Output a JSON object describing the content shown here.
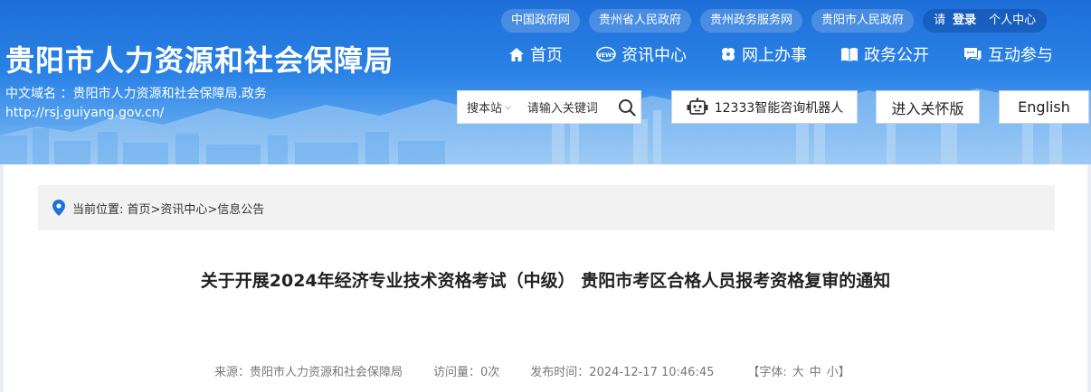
{
  "top_links": [
    "中国政府网",
    "贵州省人民政府",
    "贵州政务服务网",
    "贵阳市人民政府"
  ],
  "login": {
    "please": "请",
    "login": "登录",
    "personal": "个人中心"
  },
  "site": {
    "title": "贵阳市人力资源和社会保障局",
    "domain_label": "中文域名 ：贵阳市人力资源和社会保障局.政务",
    "url": "http://rsj.guiyang.gov.cn/"
  },
  "nav": [
    "首页",
    "资讯中心",
    "网上办事",
    "政务公开",
    "互动参与"
  ],
  "search": {
    "scope": "搜本站",
    "placeholder": "请输入关键词"
  },
  "robot_label": "12333智能咨询机器人",
  "care_label": "进入关怀版",
  "english_label": "English",
  "breadcrumb": "当前位置: 首页>资讯中心>信息公告",
  "article": {
    "title": "关于开展2024年经济专业技术资格考试（中级） 贵阳市考区合格人员报考资格复审的通知",
    "source": "来源：贵阳市人力资源和社会保障局",
    "visits": "访问量：0次",
    "published": "发布时间：2024-12-17 10:46:45",
    "font_prefix": "【字体:",
    "font_large": "大",
    "font_medium": "中",
    "font_small": "小】"
  },
  "colors": {
    "header_top": "#1e6fd8",
    "header_bottom": "#8ec3f3",
    "location_pin": "#1a73d9"
  }
}
